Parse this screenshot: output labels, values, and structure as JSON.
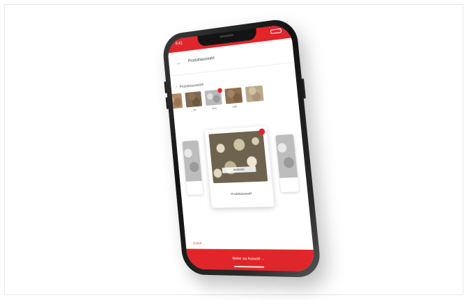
{
  "statusbar": {
    "time": "9:41"
  },
  "appbar": {
    "back_icon": "back-arrow-icon",
    "title": "Produktauswahl"
  },
  "section": {
    "label": "Produktauswahl"
  },
  "thumbnails": [
    {
      "caption": ""
    },
    {
      "caption": "Ost"
    },
    {
      "caption": "Grau"
    },
    {
      "caption": "Gelb"
    },
    {
      "caption": ""
    }
  ],
  "main_card": {
    "image_tag": "ANSEHEN",
    "caption": "Produktauswahl"
  },
  "bottom_link": "Zurück",
  "cta": {
    "label": "Weiter zur Auswahl  →"
  },
  "colors": {
    "accent": "#e0262a"
  }
}
